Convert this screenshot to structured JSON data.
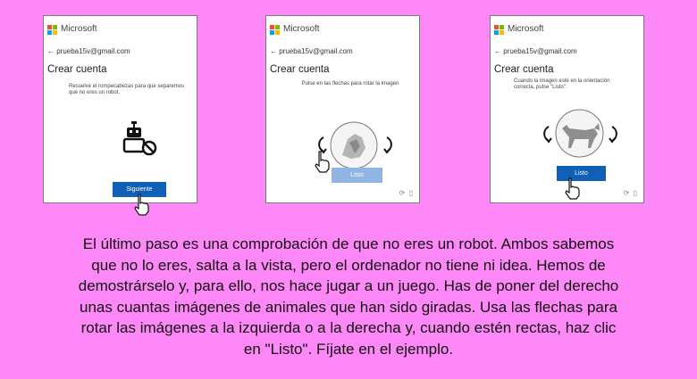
{
  "colors": {
    "background": "#ff88f8",
    "primary_button": "#0f60b6",
    "disabled_button": "#8fb5e3"
  },
  "panels": [
    {
      "brand": "Microsoft",
      "email": "← prueba15v@gmail.com",
      "heading": "Crear cuenta",
      "instruction": "Resuelve el rompecabezas para que separemos que no eres un robot.",
      "button": "Siguiente",
      "illustration": "robot-icon"
    },
    {
      "brand": "Microsoft",
      "email": "← prueba15v@gmail.com",
      "heading": "Crear cuenta",
      "instruction": "Pulse en las flechas para rotar la imagen",
      "button": "Listo",
      "illustration": "rotated-animal-image"
    },
    {
      "brand": "Microsoft",
      "email": "← prueba15v@gmail.com",
      "heading": "Crear cuenta",
      "instruction": "Cuando la imagen esté en la orientación correcta, pulse \"Listo\".",
      "button": "Listo",
      "illustration": "fox-image"
    }
  ],
  "caption": [
    "El último paso es una comprobación de que no eres un robot. Ambos sabemos",
    "que no lo eres, salta a la vista, pero el ordenador no tiene ni idea. Hemos de",
    "demostrárselo y, para ello, nos hace jugar a un juego. Has de poner del derecho",
    "unas cuantas imágenes de animales que han sido giradas. Usa las flechas para",
    "rotar las imágenes a la izquierda o a la derecha y, cuando estén rectas, haz clic",
    "en \"Listo\". Fíjate en el ejemplo."
  ]
}
